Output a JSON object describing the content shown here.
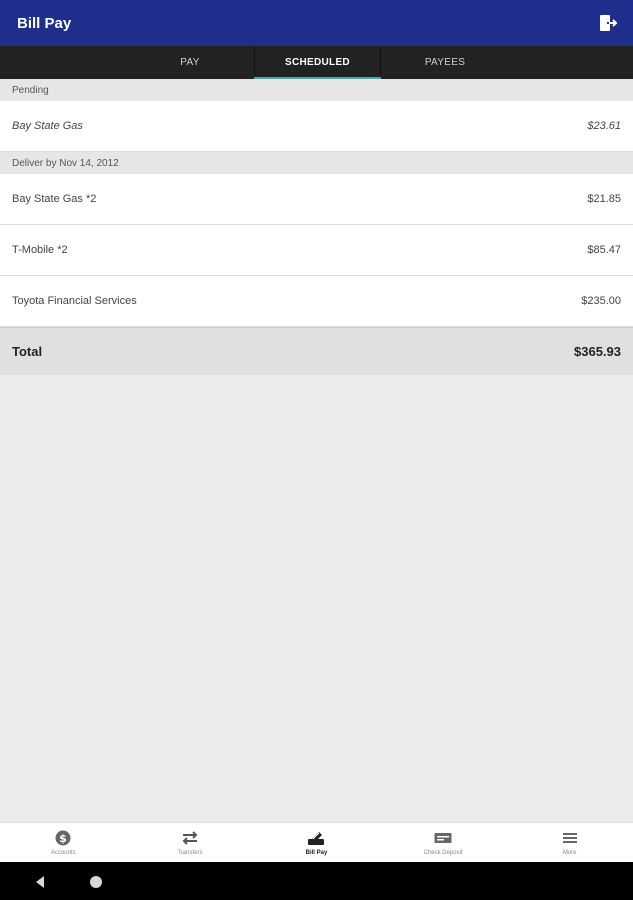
{
  "app": {
    "title": "Bill Pay"
  },
  "tabs": [
    {
      "label": "PAY"
    },
    {
      "label": "SCHEDULED"
    },
    {
      "label": "PAYEES"
    }
  ],
  "sections": [
    {
      "header": "Pending",
      "rows": [
        {
          "name": "Bay State Gas",
          "amount": "$23.61"
        }
      ]
    },
    {
      "header": "Deliver by Nov 14, 2012",
      "rows": [
        {
          "name": "Bay State Gas *2",
          "amount": "$21.85"
        },
        {
          "name": "T-Mobile *2",
          "amount": "$85.47"
        },
        {
          "name": "Toyota Financial Services",
          "amount": "$235.00"
        }
      ]
    }
  ],
  "total": {
    "label": "Total",
    "amount": "$365.93"
  },
  "bottom_nav": [
    {
      "label": "Accounts",
      "icon": "dollar-circle-icon"
    },
    {
      "label": "Transfers",
      "icon": "transfer-arrows-icon"
    },
    {
      "label": "Bill Pay",
      "icon": "bill-pay-icon"
    },
    {
      "label": "Check Deposit",
      "icon": "check-icon"
    },
    {
      "label": "More",
      "icon": "menu-icon"
    }
  ],
  "colors": {
    "appbar": "#1f2e8c",
    "tabbar": "#222222",
    "tab_indicator": "#3cb0a8",
    "background": "#ececec"
  }
}
